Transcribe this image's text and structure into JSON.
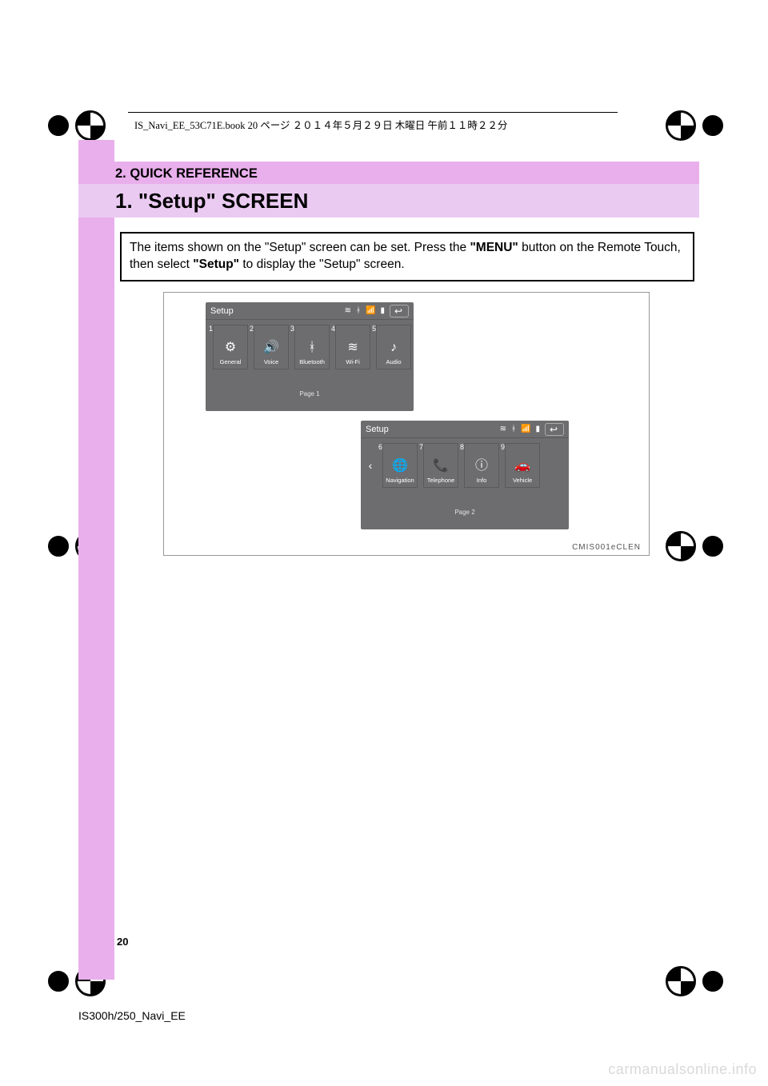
{
  "print_header": "IS_Navi_EE_53C71E.book   20 ページ   ２０１４年５月２９日   木曜日   午前１１時２２分",
  "section_banner": "2. QUICK REFERENCE",
  "title": "1. \"Setup\" SCREEN",
  "intro": {
    "t1": "The items shown on the \"Setup\" screen can be set. Press the ",
    "b1": "\"MENU\"",
    "t2": " button on the Remote Touch, then select ",
    "b2": "\"Setup\"",
    "t3": " to display the \"Setup\" screen."
  },
  "screens": {
    "s1": {
      "title": "Setup",
      "page": "Page 1",
      "tiles": [
        {
          "num": "1",
          "label": "General",
          "icon": "gear"
        },
        {
          "num": "2",
          "label": "Voice",
          "icon": "speaker"
        },
        {
          "num": "3",
          "label": "Bluetooth",
          "icon": "bluetooth"
        },
        {
          "num": "4",
          "label": "Wi-Fi",
          "icon": "wifi"
        },
        {
          "num": "5",
          "label": "Audio",
          "icon": "note"
        }
      ],
      "nav_left": false,
      "nav_right": true
    },
    "s2": {
      "title": "Setup",
      "page": "Page 2",
      "tiles": [
        {
          "num": "6",
          "label": "Navigation",
          "icon": "globe"
        },
        {
          "num": "7",
          "label": "Telephone",
          "icon": "phone"
        },
        {
          "num": "8",
          "label": "Info",
          "icon": "info"
        },
        {
          "num": "9",
          "label": "Vehicle",
          "icon": "car"
        }
      ],
      "nav_left": true,
      "nav_right": false
    }
  },
  "figure_code": "CMIS001eCLEN",
  "page_number": "20",
  "book_id": "IS300h/250_Navi_EE",
  "watermark": "carmanualsonline.info",
  "icons": {
    "gear": "⚙",
    "speaker": "🔊",
    "bluetooth": "ᚼ",
    "wifi": "≋",
    "note": "♪",
    "globe": "🌐",
    "phone": "📞",
    "info": "ⓘ",
    "car": "🚗",
    "back": "↩",
    "signal": "📶",
    "batt": "▮"
  }
}
